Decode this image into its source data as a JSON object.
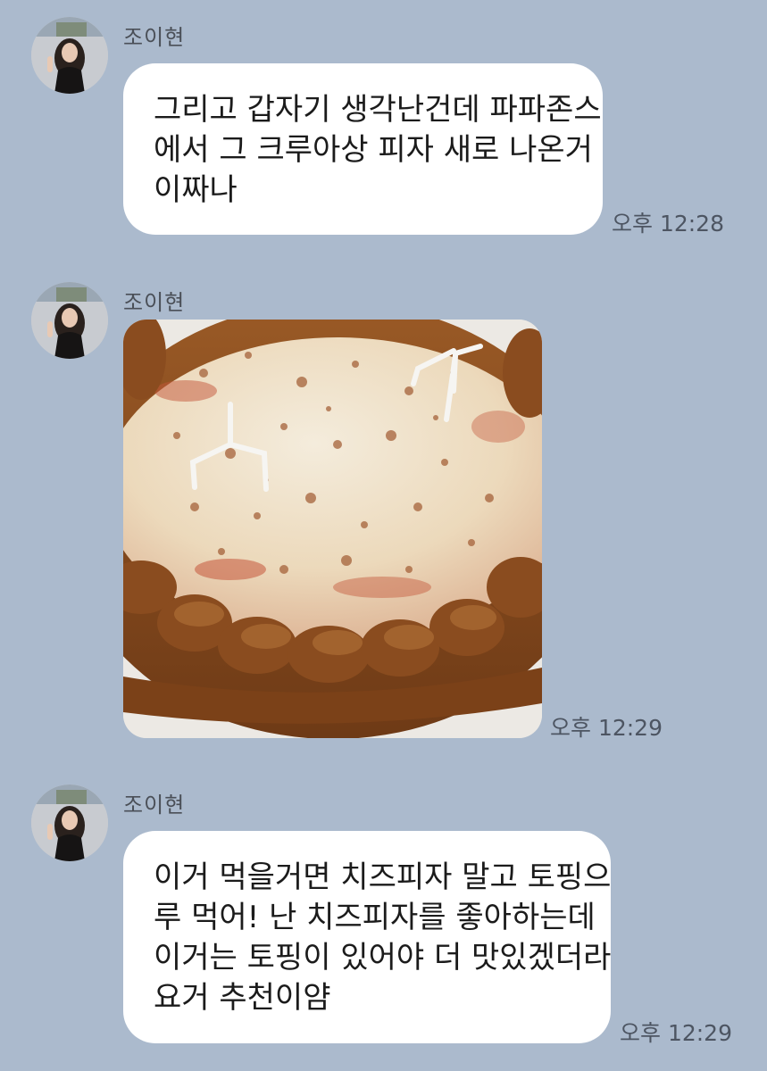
{
  "chat": {
    "messages": [
      {
        "sender": "조이현",
        "avatar_icon": "profile-photo",
        "lines": [
          "그리고 갑자기 생각난건데 파파존스",
          "에서 그 크루아상 피자 새로 나온거",
          "이짜나"
        ],
        "time": "오후 12:28"
      },
      {
        "sender": "조이현",
        "avatar_icon": "profile-photo",
        "image": "croissant-crust-cheese-pizza-photo",
        "time": "오후 12:29"
      },
      {
        "sender": "조이현",
        "avatar_icon": "profile-photo",
        "lines": [
          "이거 먹을거면 치즈피자 말고 토핑으",
          "루 먹어! 난 치즈피자를 좋아하는데",
          "이거는 토핑이 있어야 더 맛있겠더라",
          "요거 추천이얌"
        ],
        "time": "오후 12:29"
      }
    ]
  },
  "colors": {
    "background": "#abbacd",
    "bubble": "#ffffff",
    "text": "#1b1b1b",
    "meta_text": "#4d5562"
  }
}
